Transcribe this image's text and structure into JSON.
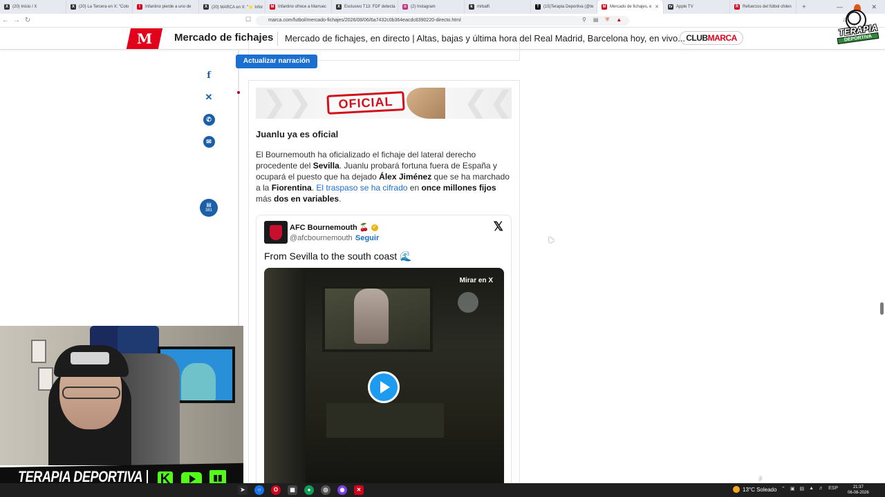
{
  "browser": {
    "tabs": [
      {
        "icon": "X",
        "label": "(20) Inicio / X",
        "color": "dark"
      },
      {
        "icon": "X",
        "label": "(20) La Tercera en X: \"Colo",
        "color": "dark"
      },
      {
        "icon": "I",
        "label": "Infantino pierde a uno de",
        "color": "red"
      },
      {
        "icon": "X",
        "label": "(20) MARCA en X: \"⭐ Infor",
        "color": "dark"
      },
      {
        "icon": "M",
        "label": "Infantino ofrece a Marruec",
        "color": "red"
      },
      {
        "icon": "X",
        "label": "Exclusivo T13: FDF detecta",
        "color": "dark"
      },
      {
        "icon": "o",
        "label": "(2) Instagram",
        "color": "ig"
      },
      {
        "icon": "k",
        "label": "mrbalfi",
        "color": "dark"
      },
      {
        "icon": "T",
        "label": "(15)Terapia Deportiva (@te",
        "color": "tt"
      },
      {
        "icon": "M",
        "label": "Mercado de fichajes, e",
        "color": "red",
        "active": true
      },
      {
        "icon": "tv",
        "label": "Apple TV",
        "color": "dark"
      },
      {
        "icon": "R",
        "label": "Refuerzos del fútbol chilen",
        "color": "red"
      }
    ],
    "new_tab": "+",
    "url": "marca.com/futbol/mercado-fichajes/2026/08/06/6a7432c0b364eacdc8390220-directo.html"
  },
  "marca": {
    "logo": "M",
    "section": "Mercado de fichajes",
    "headline": "Mercado de fichajes, en directo | Altas, bajas y última hora del Real Madrid, Barcelona hoy, en vivo...",
    "club_part1": "CLUB",
    "club_part2": "MARCA"
  },
  "live": {
    "update_button": "Actualizar narración",
    "comments_count": "381",
    "banner_stamp": "OFICIAL",
    "entry_title": "Juanlu ya es oficial",
    "body": {
      "p1": "El Bournemouth ha oficializado el fichaje del lateral derecho procedente del ",
      "b1": "Sevilla",
      "p2": ". Juanlu probará fortuna fuera de España y ocupará el puesto que ha dejado ",
      "b2": "Álex Jiménez",
      "p3": " que se ha marchado a la ",
      "b3": "Fiorentina",
      "p4": ". ",
      "link": "El traspaso se ha cifrado",
      "p5": " en ",
      "b4": "once millones fijos",
      "p6": " más ",
      "b5": "dos en variables",
      "p7": "."
    }
  },
  "tweet": {
    "name": "AFC Bournemouth",
    "emoji": "🍒",
    "handle": "@afcbournemouth",
    "follow": "Seguir",
    "x_logo": "𝕏",
    "text": "From Sevilla to the south coast",
    "text_emoji": "🌊",
    "video_label": "Mirar en X"
  },
  "overlay": {
    "logo_word1": "TERAPIA",
    "logo_word2": "DEPORTIVA",
    "stream_name": "TERAPIA DEPORTIVA",
    "kick_letter": "K"
  },
  "taskbar": {
    "weather": "13°C  Soleado",
    "lang": "ESP",
    "time": "21:37",
    "date": "06-08-2026"
  },
  "colors": {
    "marca_red": "#e2001a",
    "link_blue": "#1b6fd0",
    "share_blue": "#1b5fa8",
    "stream_green": "#53fc18"
  }
}
